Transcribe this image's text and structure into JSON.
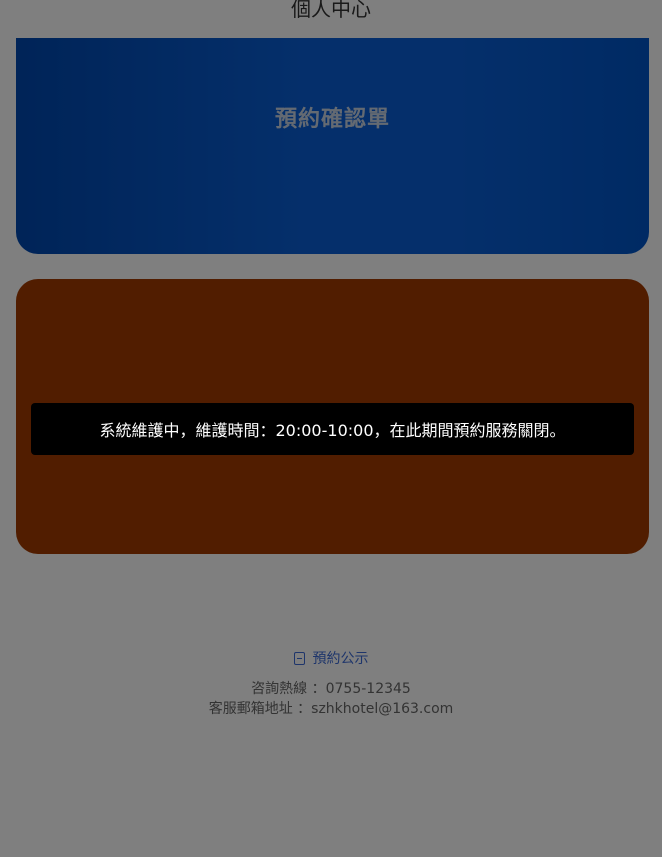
{
  "header": {
    "title": "個人中心"
  },
  "cards": {
    "reservation_confirmation": {
      "title": "預約確認單"
    }
  },
  "footer": {
    "notice_link_label": "預約公示",
    "hotline_label": "咨詢熱線 ：0755-12345",
    "email_label": "客服郵箱地址 ：szhkhotel@163.com"
  },
  "toast": {
    "message": "系統維護中，維護時間：20:00-10:00，在此期間預約服務關閉。"
  },
  "colors": {
    "card_blue": "#0a5fd6",
    "card_orange": "#a23a00",
    "link": "#3d6bd6",
    "overlay": "rgba(0,0,0,0.5)"
  },
  "icons": {
    "notice": "document-icon"
  }
}
